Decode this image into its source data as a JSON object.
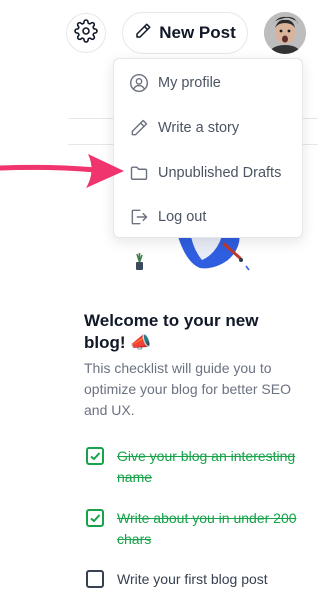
{
  "header": {
    "new_post_label": "New Post"
  },
  "dropdown": {
    "items": [
      {
        "label": "My profile",
        "icon": "user-circle-icon"
      },
      {
        "label": "Write a story",
        "icon": "pencil-icon"
      },
      {
        "label": "Unpublished Drafts",
        "icon": "folder-icon"
      },
      {
        "label": "Log out",
        "icon": "logout-icon"
      }
    ]
  },
  "welcome": {
    "title": "Welcome to your new blog! 📣",
    "description": "This checklist will guide you to optimize your blog for better SEO and UX.",
    "checklist": [
      {
        "label": "Give your blog an interesting name",
        "done": true
      },
      {
        "label": "Write about you in under 200 chars",
        "done": true
      },
      {
        "label": "Write your first blog post",
        "done": false
      }
    ]
  },
  "colors": {
    "done_green": "#16a34a",
    "annotation_arrow": "#f0346e",
    "menu_text": "#4b5563"
  }
}
